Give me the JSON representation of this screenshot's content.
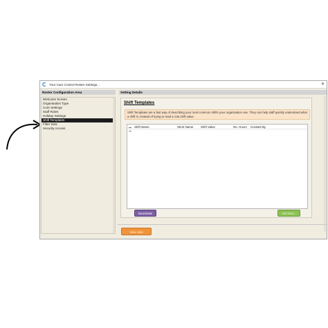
{
  "window": {
    "title": "Your Care Control Roster Settings..."
  },
  "left": {
    "header": "Roster Configuration Area",
    "items": [
      {
        "label": "Welcome Screen"
      },
      {
        "label": "Organisation Type"
      },
      {
        "label": "Core Settings"
      },
      {
        "label": "Staff Roles"
      },
      {
        "label": "Holiday Settings"
      },
      {
        "label": "Shift Templates",
        "selected": true
      },
      {
        "label": "Filter Sets"
      },
      {
        "label": "Security Access"
      }
    ]
  },
  "right": {
    "header": "Setting Details",
    "panel_title": "Shift Templates",
    "description": "Shift Templates are a fast way of describing your most common shifts your organisation use.  They can help staff quickly understand what a shift is, instead of trying to read a rota shift value.",
    "columns": [
      "Shift Name",
      "Short Name",
      "Shift Value",
      "No. Hours",
      "Created By"
    ],
    "buttons": {
      "deactivate": "Deactivate",
      "add_new": "Add New..."
    }
  },
  "footer": {
    "help_label": "View Help"
  },
  "colors": {
    "deactivate": "#7d5fa6",
    "add_new": "#8cc152",
    "help": "#f0943c",
    "selected": "#1c1c1c"
  }
}
